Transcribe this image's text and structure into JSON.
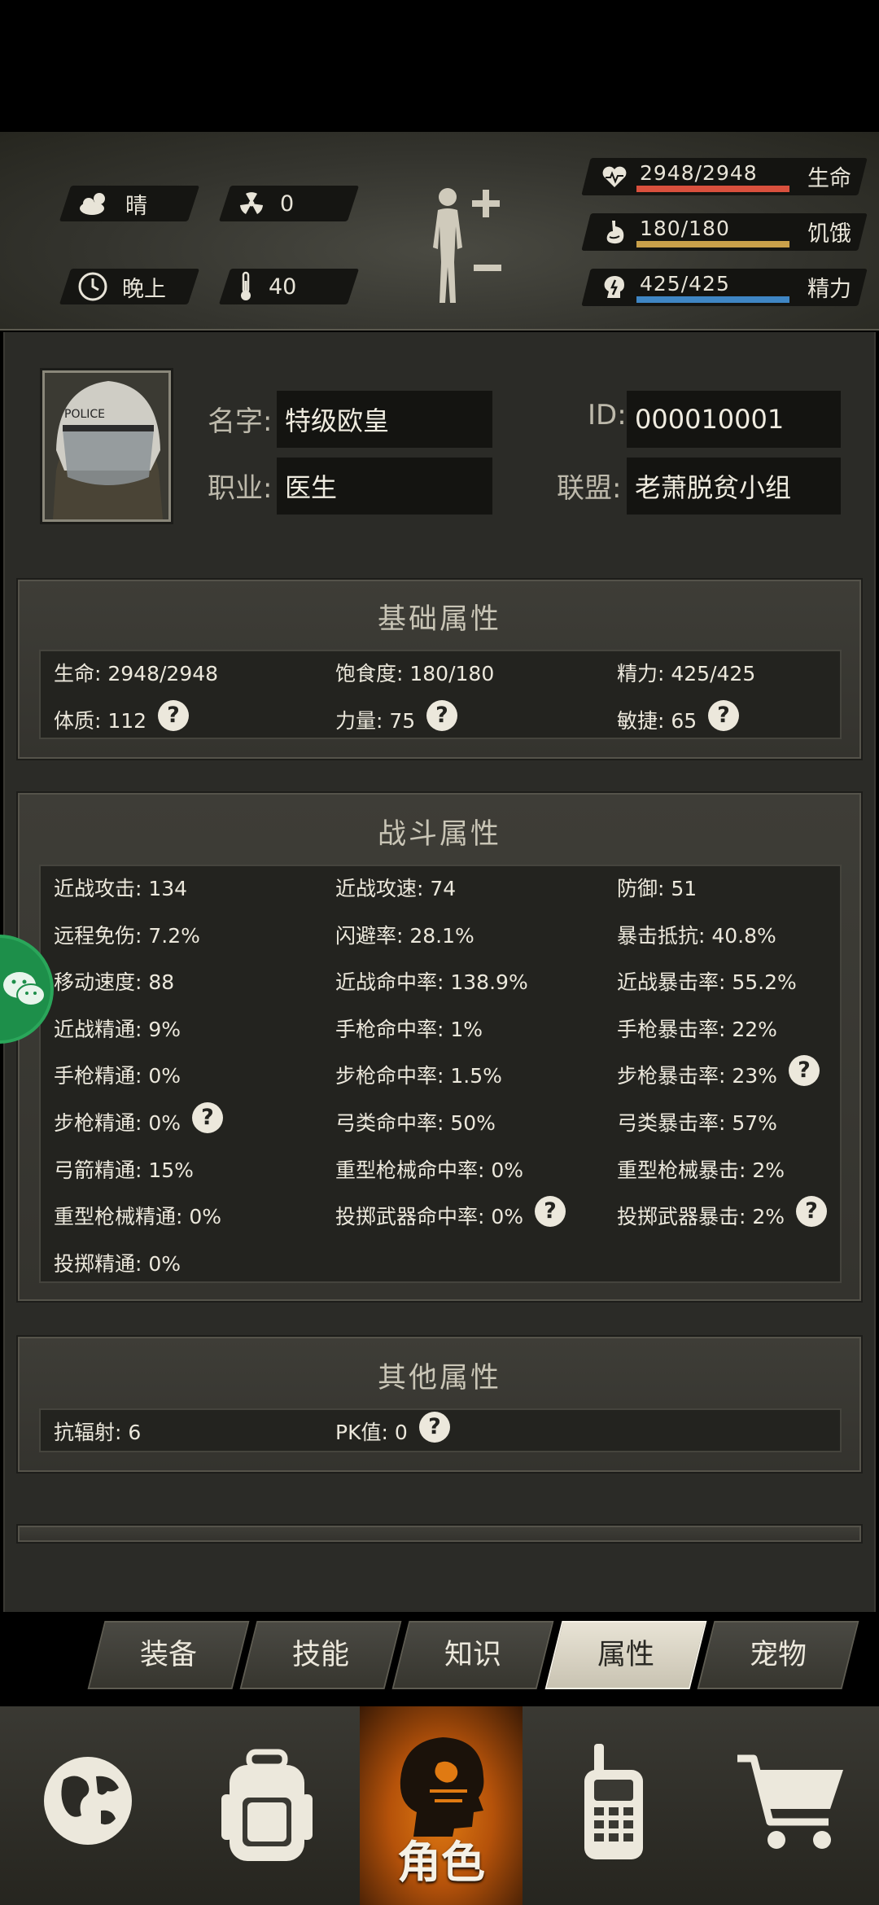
{
  "status": {
    "weather": "晴",
    "radiation": "0",
    "time_of_day": "晚上",
    "temperature": "40",
    "stats": [
      {
        "value": "2948/2948",
        "name": "生命",
        "fraction": 1.0,
        "color": "#d9503d",
        "icon": "heart-icon"
      },
      {
        "value": "180/180",
        "name": "饥饿",
        "fraction": 1.0,
        "color": "#c9a04a",
        "icon": "stomach-icon"
      },
      {
        "value": "425/425",
        "name": "精力",
        "fraction": 1.0,
        "color": "#3f86c4",
        "icon": "brain-icon"
      }
    ]
  },
  "profile": {
    "name_label": "名字:",
    "name": "特级欧皇",
    "id_label": "ID:",
    "id": "000010001",
    "job_label": "职业:",
    "job": "医生",
    "alliance_label": "联盟:",
    "alliance": "老萧脱贫小组"
  },
  "basic": {
    "title": "基础属性",
    "items": [
      {
        "text": "生命: 2948/2948"
      },
      {
        "text": "饱食度: 180/180"
      },
      {
        "text": "精力: 425/425"
      },
      {
        "text": "体质: 112",
        "help": true
      },
      {
        "text": "力量: 75",
        "help": true
      },
      {
        "text": "敏捷: 65",
        "help": true
      }
    ]
  },
  "combat": {
    "title": "战斗属性",
    "items": [
      {
        "text": "近战攻击: 134"
      },
      {
        "text": "近战攻速: 74"
      },
      {
        "text": "防御: 51"
      },
      {
        "text": "远程免伤: 7.2%"
      },
      {
        "text": "闪避率: 28.1%"
      },
      {
        "text": "暴击抵抗: 40.8%"
      },
      {
        "text": "移动速度: 88"
      },
      {
        "text": "近战命中率: 138.9%"
      },
      {
        "text": "近战暴击率: 55.2%"
      },
      {
        "text": "近战精通: 9%"
      },
      {
        "text": "手枪命中率: 1%"
      },
      {
        "text": "手枪暴击率: 22%"
      },
      {
        "text": "手枪精通: 0%"
      },
      {
        "text": "步枪命中率: 1.5%"
      },
      {
        "text": "步枪暴击率: 23%",
        "help": true
      },
      {
        "text": "步枪精通: 0%",
        "help": true
      },
      {
        "text": "弓类命中率: 50%"
      },
      {
        "text": "弓类暴击率: 57%"
      },
      {
        "text": "弓箭精通: 15%"
      },
      {
        "text": "重型枪械命中率: 0%"
      },
      {
        "text": "重型枪械暴击: 2%"
      },
      {
        "text": "重型枪械精通: 0%"
      },
      {
        "text": "投掷武器命中率: 0%",
        "help": true
      },
      {
        "text": "投掷武器暴击: 2%",
        "help": true
      },
      {
        "text": "投掷精通: 0%"
      }
    ]
  },
  "other": {
    "title": "其他属性",
    "items": [
      {
        "text": "抗辐射: 6"
      },
      {
        "text": "PK值: 0",
        "help": true
      }
    ]
  },
  "help_glyph": "?",
  "tabs": [
    {
      "label": "装备",
      "active": false
    },
    {
      "label": "技能",
      "active": false
    },
    {
      "label": "知识",
      "active": false
    },
    {
      "label": "属性",
      "active": true
    },
    {
      "label": "宠物",
      "active": false
    }
  ],
  "nav": [
    {
      "icon": "globe-icon",
      "label": ""
    },
    {
      "icon": "backpack-icon",
      "label": ""
    },
    {
      "icon": "character-head-icon",
      "label": "角色",
      "active": true
    },
    {
      "icon": "walkie-talkie-icon",
      "label": ""
    },
    {
      "icon": "shopping-cart-icon",
      "label": ""
    }
  ]
}
